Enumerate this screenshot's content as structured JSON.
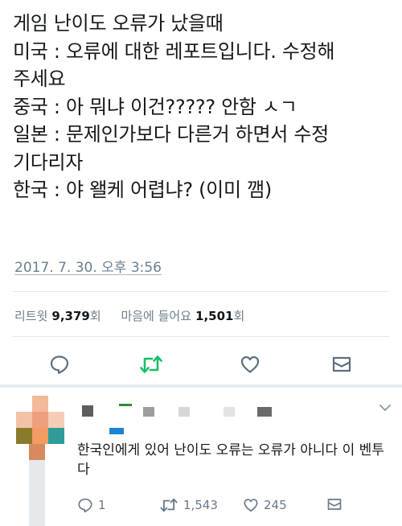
{
  "tweet": {
    "lines": [
      "게임 난이도 오류가 났을때",
      "미국 : 오류에 대한 레포트입니다. 수정해",
      "주세요",
      "중국 : 아 뭐냐 이건????? 안함 ㅅㄱ",
      "일본 : 문제인가보다 다른거 하면서 수정",
      "기다리자",
      "한국 : 야 왤케 어렵냐? (이미 깸)"
    ],
    "timestamp": "2017. 7. 30. 오후 3:56",
    "retweets_label": "리트윗",
    "retweets_count": "9,379",
    "retweets_unit": "회",
    "likes_label": "마음에 들어요",
    "likes_count": "1,501",
    "likes_unit": "회"
  },
  "reply": {
    "text": "한국인에게 있어 난이도 오류는 오류가 아니다 이 벤투다",
    "reply_count": "1",
    "retweet_count": "1,543",
    "like_count": "245"
  },
  "colors": {
    "accent_blue": "#1da1f2",
    "retweet_green": "#17bf63",
    "muted_gray": "#657786",
    "separator": "#e6ecf0"
  },
  "icons": {
    "reply": "speech-bubble",
    "retweet": "retweet-arrows",
    "like": "heart-outline",
    "message": "envelope",
    "more": "chevron-down"
  }
}
